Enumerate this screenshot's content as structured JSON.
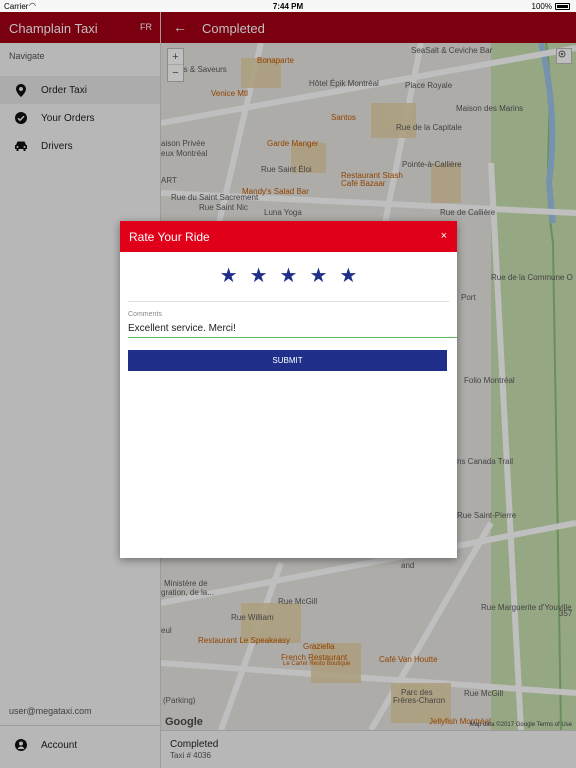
{
  "status_bar": {
    "carrier": "Carrier",
    "time": "7:44 PM",
    "battery": "100%"
  },
  "sidebar": {
    "brand": "Champlain Taxi",
    "lang": "FR",
    "nav_caption": "Navigate",
    "items": [
      {
        "label": "Order Taxi",
        "icon": "location-pin-icon"
      },
      {
        "label": "Your Orders",
        "icon": "check-circle-icon"
      },
      {
        "label": "Drivers",
        "icon": "car-icon"
      }
    ],
    "user_email": "user@megataxi.com",
    "account_label": "Account"
  },
  "header": {
    "title": "Completed"
  },
  "map": {
    "labels": [
      "SeaSalt & Ceviche Bar",
      "Bonaparte",
      "liers & Saveurs",
      "Hôtel Épik Montréal",
      "Place Royale",
      "Venice Mtl",
      "Maison des Marins",
      "Santos",
      "Rue de la Capitale",
      "aison Privée",
      "eux Montréal",
      "Garde Manger",
      "Pointe-à-Callière",
      "Rue Saint Éloi",
      "Restaurant Stash",
      "Café Bazaar",
      "ART",
      "Mandy's Salad Bar",
      "Rue du Saint Sacrement",
      "Rue Saint Nic",
      "Luna Yoga",
      "Rue de Callière",
      "Rue de la Commune O",
      "Port",
      "Folio Montréal",
      "ns Canada Trail",
      "Rue Saint-Pierre",
      "Ministère de",
      "gration, de la...",
      "and",
      "Rue McGill",
      "Rue William",
      "eul",
      "Restaurant Le Speakeasy",
      "Graziella",
      "French Restaurant",
      "Le Cartet Resto Boutique",
      "Café Van Houtte",
      "Rue Marguerite d'Youville",
      "(Parking)",
      "Parc des",
      "Frères-Charon",
      "Rue McGill",
      "Jellyfish Montréal",
      "357"
    ],
    "google": "Google",
    "attribution": "Map data ©2017 Google   Terms of Use"
  },
  "bottom_panel": {
    "status": "Completed",
    "taxi": "Taxi # 4036"
  },
  "modal": {
    "title": "Rate Your Ride",
    "close": "×",
    "rating": 5,
    "max_rating": 5,
    "comments_label": "Comments",
    "comments_value": "Excellent service. Merci!",
    "submit_label": "SUBMIT"
  }
}
